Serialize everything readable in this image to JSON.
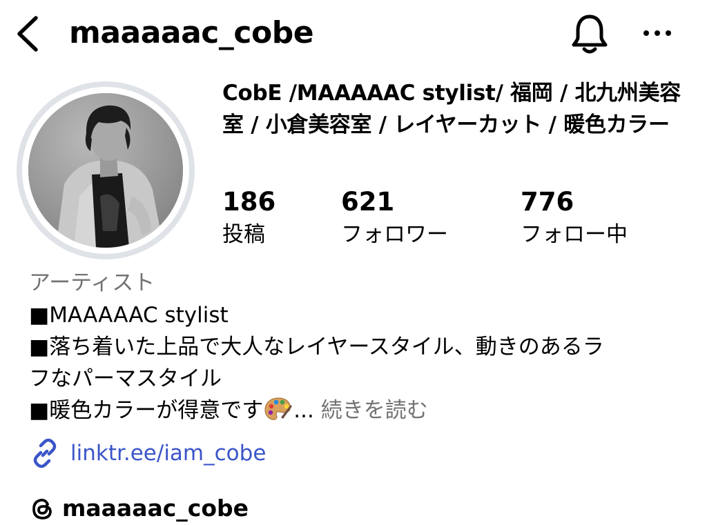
{
  "header": {
    "username": "maaaaac_cobe",
    "icons": {
      "back": "chevron-left-icon",
      "notifications": "bell-icon",
      "more": "more-horizontal-icon"
    }
  },
  "profile": {
    "display_name": "CobE /MAAAAAC stylist/ 福岡 / 北九州美容室 / 小倉美容室 / レイヤーカット / 暖色カラー",
    "stats": [
      {
        "value": "186",
        "label": "投稿"
      },
      {
        "value": "621",
        "label": "フォロワー"
      },
      {
        "value": "776",
        "label": "フォロー中"
      }
    ],
    "category": "アーティスト",
    "bio": {
      "line1": "■MAAAAAC stylist",
      "line2": "■落ち着いた上品で大人なレイヤースタイル、動きのあるラ",
      "line3": "フなパーマスタイル",
      "line4": "■暖色カラーが得意です",
      "ellipsis": "...",
      "more_label": "続きを読む",
      "emoji_icon": "artist-palette-icon"
    },
    "link": {
      "text": "linktr.ee/iam_cobe",
      "icon": "link-icon"
    },
    "threads": {
      "username": "maaaaac_cobe",
      "icon": "threads-icon"
    }
  },
  "colors": {
    "link_blue": "#3b55c9",
    "secondary_text": "#737373",
    "avatar_ring": "#dfe2e6"
  }
}
